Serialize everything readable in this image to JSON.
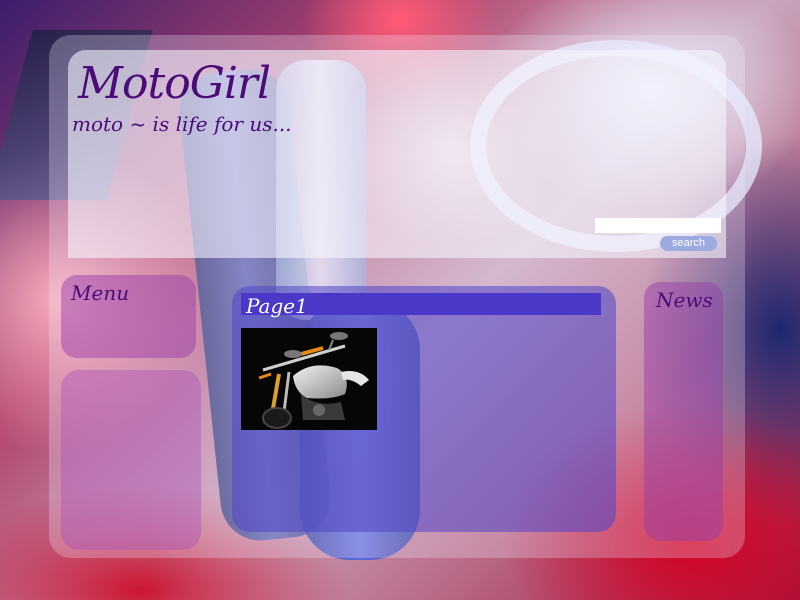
{
  "site": {
    "title": "MotoGirl",
    "tagline": "moto ~ is life for us..."
  },
  "search": {
    "value": "",
    "placeholder": "",
    "button_label": "search"
  },
  "menu": {
    "title": "Menu"
  },
  "content": {
    "page_title": "Page1",
    "image": "motorcycle-photo"
  },
  "news": {
    "title": "News"
  },
  "colors": {
    "title_text": "#4b0c78",
    "content_bar": "#4a38c9",
    "panel_purple": "#963caa",
    "search_button": "#9daae0"
  }
}
